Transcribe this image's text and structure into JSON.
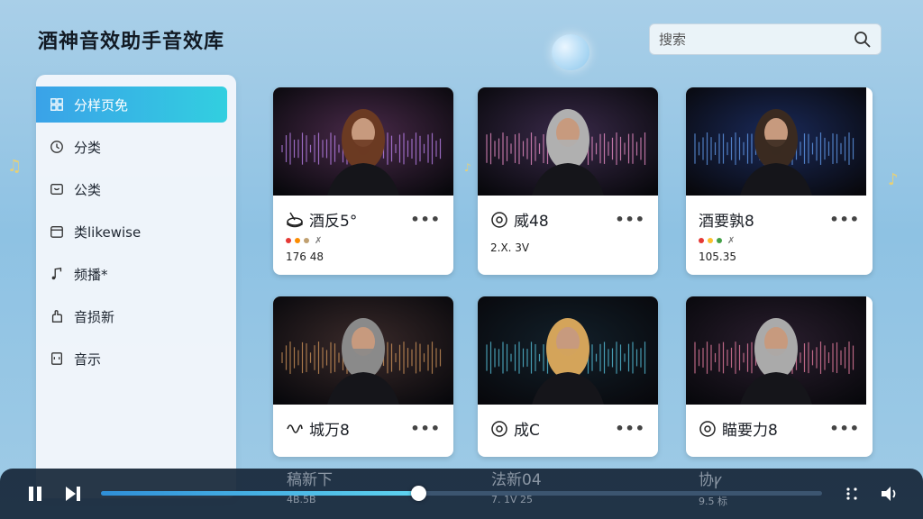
{
  "app": {
    "title": "酒神音效助手音效库"
  },
  "search": {
    "placeholder": "搜索"
  },
  "sidebar": {
    "items": [
      {
        "label": "分样页免",
        "icon": "grid-icon",
        "active": true
      },
      {
        "label": "分类",
        "icon": "clock-icon",
        "active": false
      },
      {
        "label": "公类",
        "icon": "folder-icon",
        "active": false
      },
      {
        "label": "类likewise",
        "icon": "calendar-icon",
        "active": false
      },
      {
        "label": "频播*",
        "icon": "music-note-icon",
        "active": false
      },
      {
        "label": "音损新",
        "icon": "hand-icon",
        "active": false
      },
      {
        "label": "音示",
        "icon": "file-icon",
        "active": false
      }
    ]
  },
  "cards": [
    {
      "title": "酒反5°",
      "icon": "drum-icon",
      "tags": [
        "#e53935",
        "#fb8c00",
        "#c0a070"
      ],
      "tag_text": "✗",
      "meta": "176 48",
      "more": "•••"
    },
    {
      "title": "威48",
      "icon": "vinyl-icon",
      "tags": [],
      "tag_text": "",
      "meta": "2.X. 3V",
      "more": "•••"
    },
    {
      "title": "酒要孰8",
      "icon": "none",
      "tags": [
        "#e53935",
        "#fbc02d",
        "#43a047"
      ],
      "tag_text": "✗",
      "meta": "105.35",
      "more": "•••"
    },
    {
      "title": "城万8",
      "icon": "wave-icon",
      "tags": [],
      "tag_text": "",
      "meta": "",
      "more": "•••"
    },
    {
      "title": "成C",
      "icon": "vinyl-icon",
      "tags": [],
      "tag_text": "",
      "meta": "",
      "more": "•••"
    },
    {
      "title": "瞄要力8",
      "icon": "vinyl-icon",
      "tags": [],
      "tag_text": "",
      "meta": "",
      "more": "•••"
    }
  ],
  "ghost_row": {
    "items": [
      {
        "title": "稿新下",
        "meta": "4B.5B"
      },
      {
        "title": "法新04",
        "meta": "7. 1V 25"
      },
      {
        "title": "协ꝩ",
        "meta": "9.5 标"
      }
    ]
  },
  "player": {
    "progress": 0.44,
    "play_icon": "pause-icon",
    "next_icon": "next-icon",
    "menu_icon": "more-vertical-icon",
    "volume_icon": "volume-icon"
  },
  "colors": {
    "accent_start": "#3aa2e8",
    "accent_end": "#32cfe0",
    "player_bg": "#18283a"
  }
}
